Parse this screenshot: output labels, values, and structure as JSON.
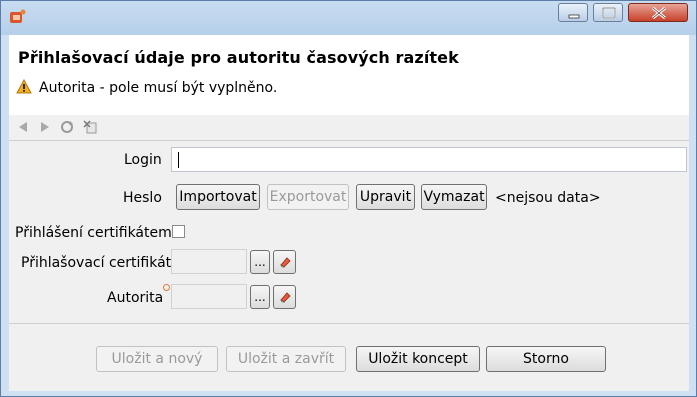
{
  "window": {
    "icon": "app-icon",
    "controls": [
      "minimize-icon",
      "maximize-icon",
      "close-icon"
    ]
  },
  "header": {
    "title": "Přihlašovací údaje pro autoritu časových razítek",
    "warning": "Autorita - pole musí být vyplněno.",
    "warning_icon": "warning-icon"
  },
  "toolbar": {
    "icons": [
      "back-icon",
      "forward-icon",
      "refresh-icon",
      "detach-icon"
    ]
  },
  "form": {
    "login_label": "Login",
    "login_value": "",
    "heslo_label": "Heslo",
    "import_label": "Importovat",
    "export_label": "Exportovat",
    "edit_label": "Upravit",
    "delete_label": "Vymazat",
    "no_data": "<nejsou data>",
    "cert_login_label": "Přihlášení certifikátem",
    "cert_login_checked": false,
    "cert_label": "Přihlašovací certifikát",
    "authority_label": "Autorita",
    "browse_label": "...",
    "clear_icon": "eraser-icon"
  },
  "footer": {
    "save_new": "Uložit a nový",
    "save_close": "Uložit a zavřít",
    "save_draft": "Uložit koncept",
    "cancel": "Storno"
  },
  "colors": {
    "frame": "#c8dcf1",
    "content_bg": "#f0f0f0",
    "warning": "#f2b01e",
    "close_button": "#c7412a"
  }
}
